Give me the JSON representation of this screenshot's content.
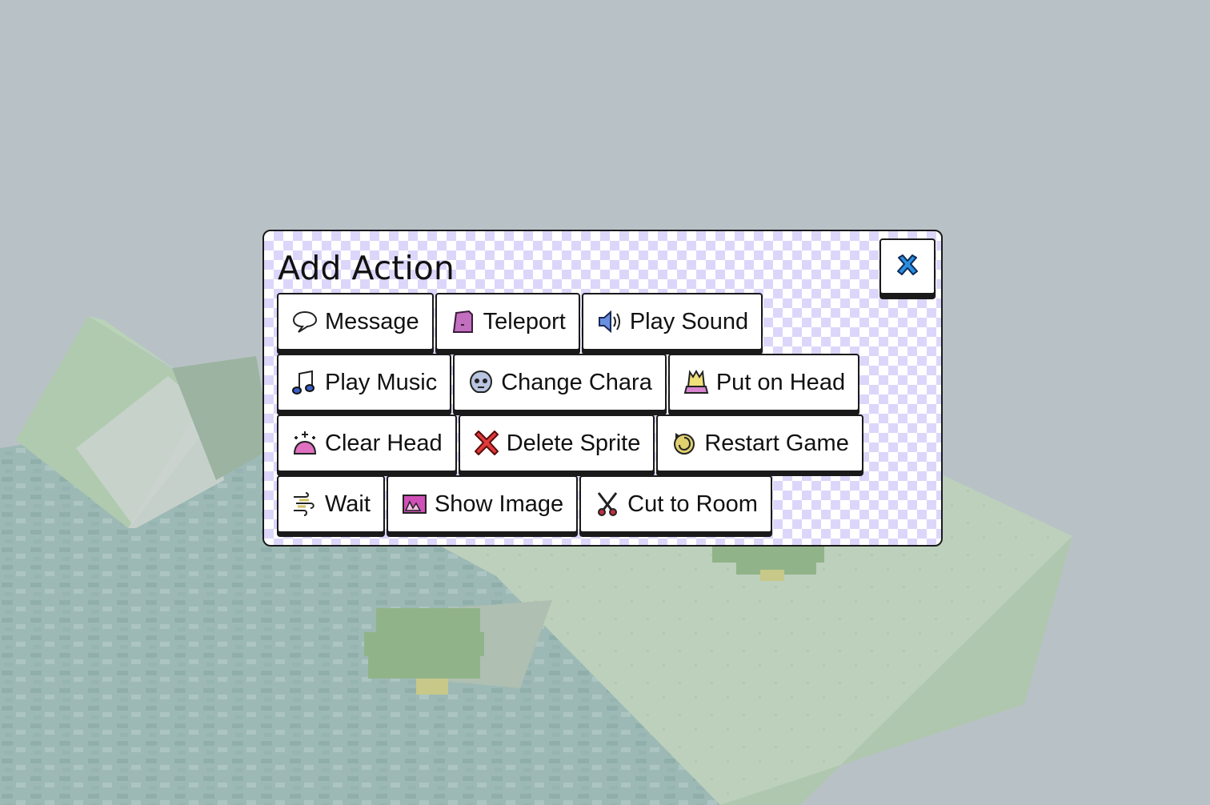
{
  "dialog": {
    "title": "Add Action",
    "close_icon": "close-x-icon"
  },
  "actions": [
    [
      {
        "label": "Message",
        "icon": "speech-bubble-icon"
      },
      {
        "label": "Teleport",
        "icon": "teleport-icon"
      },
      {
        "label": "Play Sound",
        "icon": "speaker-icon"
      }
    ],
    [
      {
        "label": "Play Music",
        "icon": "music-note-icon"
      },
      {
        "label": "Change Chara",
        "icon": "skull-mask-icon"
      },
      {
        "label": "Put on Head",
        "icon": "bell-hat-icon"
      }
    ],
    [
      {
        "label": "Clear Head",
        "icon": "sparkle-blob-icon"
      },
      {
        "label": "Delete Sprite",
        "icon": "red-x-icon"
      },
      {
        "label": "Restart Game",
        "icon": "restart-swirl-icon"
      }
    ],
    [
      {
        "label": "Wait",
        "icon": "wind-lines-icon"
      },
      {
        "label": "Show Image",
        "icon": "image-icon"
      },
      {
        "label": "Cut to Room",
        "icon": "scissors-icon"
      }
    ]
  ],
  "colors": {
    "background": "#b3bcc0",
    "dialog_checker": "#dcd6fb",
    "border": "#1a1a1a",
    "ground": "#b8cdb0"
  }
}
